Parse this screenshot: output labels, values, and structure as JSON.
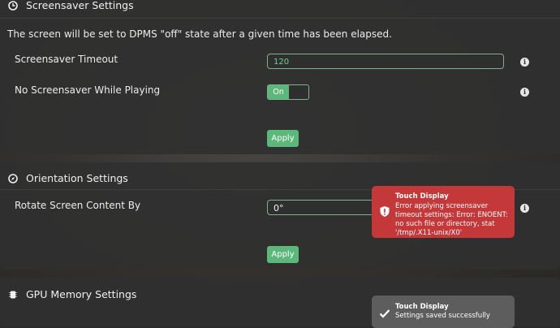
{
  "screensaver": {
    "title": "Screensaver Settings",
    "description": "The screen will be set to DPMS \"off\" state after a given time has been elapsed.",
    "timeout_label": "Screensaver Timeout",
    "timeout_value": "120",
    "no_screensaver_label": "No Screensaver While Playing",
    "toggle_label": "On",
    "apply_label": "Apply"
  },
  "orientation": {
    "title": "Orientation Settings",
    "rotate_label": "Rotate Screen Content By",
    "rotate_value": "0°",
    "apply_label": "Apply"
  },
  "gpu": {
    "title": "GPU Memory Settings"
  },
  "toasts": {
    "error": {
      "title": "Touch Display",
      "message": "Error applying screensaver timeout settings: Error: ENOENT: no such file or directory, stat '/tmp/.X11-unix/X0'"
    },
    "success": {
      "title": "Touch Display",
      "message": "Settings saved successfully"
    }
  },
  "colors": {
    "accent": "#5cb87a",
    "error": "#c4383a",
    "panel": "#303030"
  },
  "icons": {
    "screensaver": "clock-icon",
    "orientation": "compass-icon",
    "gpu": "chip-icon",
    "info": "info-icon",
    "error": "shield-alert-icon",
    "success": "check-icon"
  }
}
